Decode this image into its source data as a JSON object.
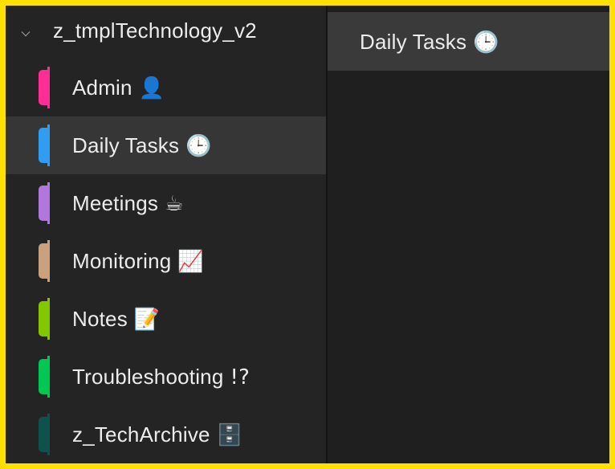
{
  "notebook": {
    "title": "z_tmplTechnology_v2",
    "expanded_icon": "chevron-down-icon"
  },
  "sections": [
    {
      "label": "Admin",
      "emoji": "👤",
      "color": "#ff2d95",
      "selected": false
    },
    {
      "label": "Daily Tasks",
      "emoji": "🕒",
      "color": "#2e9df2",
      "selected": true
    },
    {
      "label": "Meetings",
      "emoji": "☕",
      "color": "#b277dd",
      "selected": false
    },
    {
      "label": "Monitoring",
      "emoji": "📈",
      "color": "#c9a27d",
      "selected": false
    },
    {
      "label": "Notes",
      "emoji": "📝",
      "color": "#83c700",
      "selected": false
    },
    {
      "label": "Troubleshooting",
      "emoji": "!?",
      "color": "#00c853",
      "selected": false
    },
    {
      "label": "z_TechArchive",
      "emoji": "🗄️",
      "color": "#0f514c",
      "selected": false
    }
  ],
  "page": {
    "title": "Daily Tasks",
    "emoji": "🕒"
  },
  "colors": {
    "frame_border": "#ffe000",
    "sidebar_bg": "#242424",
    "selected_bg": "#363636",
    "content_bg": "#1f1f1f",
    "page_row_bg": "#3a3a3a",
    "text": "#ececec"
  }
}
